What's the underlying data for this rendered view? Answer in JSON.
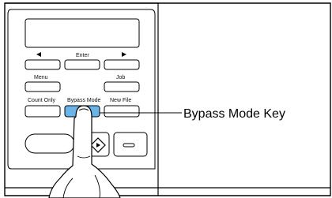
{
  "panel": {
    "enter_label": "Enter",
    "menu_label": "Menu",
    "job_label": "Job",
    "count_only_label": "Count Only",
    "bypass_mode_label": "Bypass Mode",
    "new_file_label": "New File",
    "left_arrow_icon": "left-arrow-icon",
    "right_arrow_icon": "right-arrow-icon",
    "start_icon": "start-diamond-icon",
    "stop_icon": "stop-icon"
  },
  "callout": {
    "label": "Bypass Mode Key"
  },
  "colors": {
    "highlight_key": "#6ab4e8",
    "outline": "#000000"
  }
}
